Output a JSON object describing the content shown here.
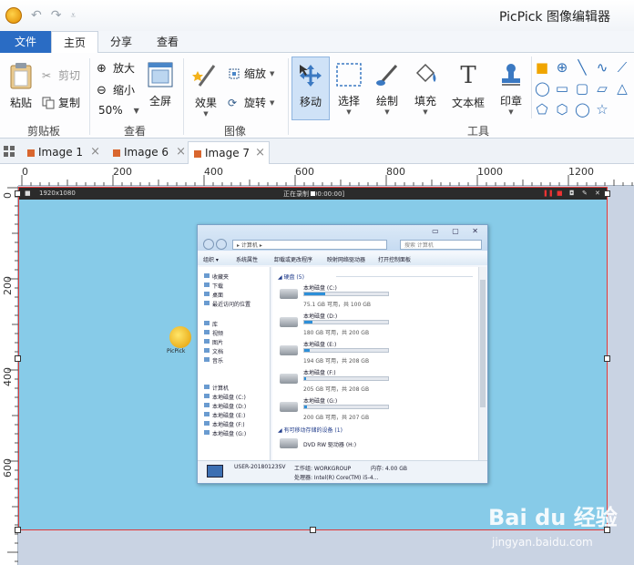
{
  "titlebar": {
    "title": "PicPick 图像编辑器",
    "undo": "↶",
    "redo": "↷",
    "dropdown": "⩡"
  },
  "menu": {
    "file": "文件",
    "home": "主页",
    "share": "分享",
    "view": "查看"
  },
  "ribbon": {
    "clipboard": {
      "paste": "粘贴",
      "cut": "剪切",
      "copy": "复制",
      "label": "剪贴板"
    },
    "view": {
      "zoom_in": "放大",
      "zoom_out": "缩小",
      "zoom_level": "50%",
      "fullscreen": "全屏",
      "label": "查看"
    },
    "image": {
      "effects": "效果",
      "resize": "缩放",
      "rotate": "旋转",
      "label": "图像"
    },
    "tools": {
      "move": "移动",
      "select": "选择",
      "draw": "绘制",
      "fill": "填充",
      "text": "文本框",
      "stamp": "印章",
      "label": "工具"
    },
    "shapes": [
      "■",
      "⊕",
      "╲",
      "∿",
      "⟋",
      "◯",
      "▭",
      "▢",
      "▱",
      "△",
      "⬠",
      "⬡",
      "◯",
      "☆"
    ]
  },
  "doctabs": [
    {
      "label": "Image 1",
      "close": "×"
    },
    {
      "label": "Image 6",
      "close": "×"
    },
    {
      "label": "Image 7",
      "close": "×"
    }
  ],
  "ruler": {
    "top": [
      "0",
      "200",
      "400",
      "600",
      "800",
      "1000",
      "1200"
    ],
    "left": [
      "0",
      "200",
      "400",
      "600"
    ]
  },
  "screenshot": {
    "rec_left": "1920x1080",
    "rec_center": "正在录制 [00:00:00]",
    "desktop_icon_label": "PicPick",
    "explorer": {
      "address": "▸ 计算机 ▸",
      "search": "搜索 计算机",
      "window_buttons": "▭ ▢ ✕",
      "toolbar": [
        "组织 ▾",
        "系统属性",
        "卸载或更改程序",
        "映射网络驱动器",
        "打开控制面板"
      ],
      "nav": [
        "收藏夹",
        "下载",
        "桌面",
        "最近访问的位置",
        "库",
        "视频",
        "图片",
        "文档",
        "音乐",
        "计算机",
        "本地磁盘 (C:)",
        "本地磁盘 (D:)",
        "本地磁盘 (E:)",
        "本地磁盘 (F:)",
        "本地磁盘 (G:)"
      ],
      "hdd_title": "◢ 硬盘 (5)",
      "drives": [
        {
          "name": "本地磁盘 (C:)",
          "stat": "75.1 GB 可用，共 100 GB",
          "fill": 0.25
        },
        {
          "name": "本地磁盘 (D:)",
          "stat": "180 GB 可用，共 200 GB",
          "fill": 0.1
        },
        {
          "name": "本地磁盘 (E:)",
          "stat": "194 GB 可用，共 208 GB",
          "fill": 0.07
        },
        {
          "name": "本地磁盘 (F:)",
          "stat": "205 GB 可用，共 208 GB",
          "fill": 0.02
        },
        {
          "name": "本地磁盘 (G:)",
          "stat": "200 GB 可用，共 207 GB",
          "fill": 0.03
        }
      ],
      "removable_title": "◢ 有可移动存储的设备 (1)",
      "dvd": "DVD RW 驱动器 (H:)",
      "status": {
        "name": "USER-20180123SV",
        "group": "工作组: WORKGROUP",
        "memory": "内存: 4.00 GB",
        "cpu": "处理器: Intel(R) Core(TM) i5-4..."
      }
    }
  },
  "watermark": {
    "logo": "Bai du 经验",
    "url": "jingyan.baidu.com"
  }
}
